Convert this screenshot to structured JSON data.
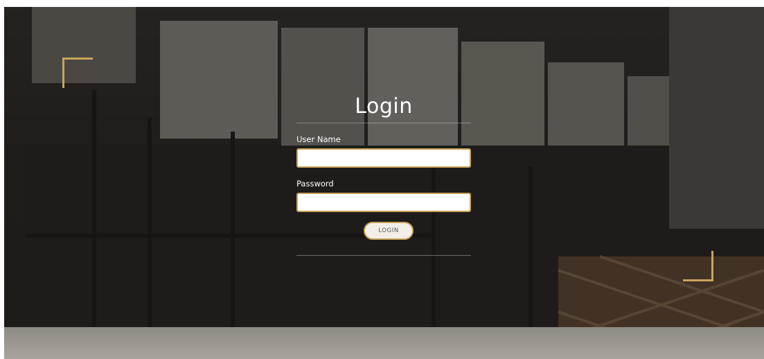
{
  "login": {
    "title": "Login",
    "username_label": "User Name",
    "username_value": "",
    "password_label": "Password",
    "password_value": "",
    "button_label": "LOGIN"
  },
  "colors": {
    "accent": "#c9a45c",
    "overlay": "#1a1816"
  }
}
